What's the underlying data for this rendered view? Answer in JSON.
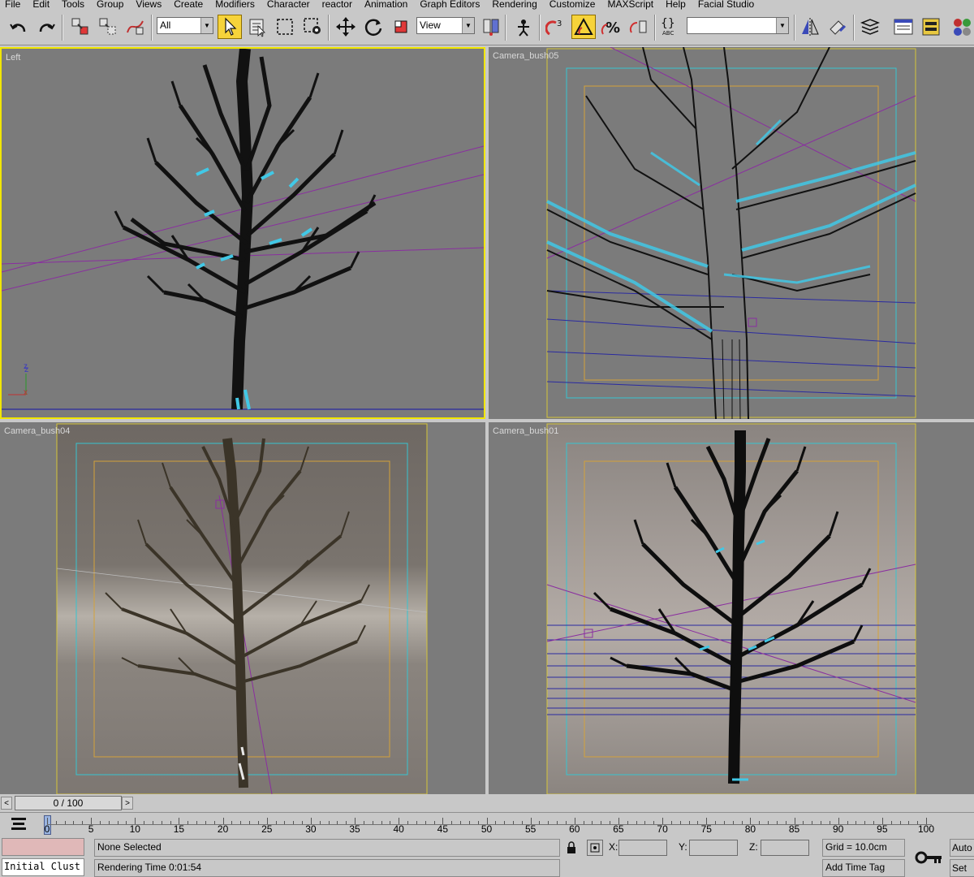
{
  "menu": [
    "File",
    "Edit",
    "Tools",
    "Group",
    "Views",
    "Create",
    "Modifiers",
    "Character",
    "reactor",
    "Animation",
    "Graph Editors",
    "Rendering",
    "Customize",
    "MAXScript",
    "Help",
    "Facial Studio"
  ],
  "toolbar": {
    "selection_filter": "All",
    "reference_coord": "View",
    "named_selection": "",
    "icons": [
      "undo-icon",
      "redo-icon",
      "link-icon",
      "unlink-icon",
      "bind-spacewarp-icon",
      "select-object-icon",
      "select-by-name-icon",
      "rect-region-icon",
      "window-crossing-icon",
      "move-icon",
      "rotate-icon",
      "scale-icon",
      "mirror-icon",
      "align-icon",
      "layer-manager-icon",
      "curve-editor-icon",
      "schematic-view-icon",
      "material-editor-icon"
    ],
    "colors": {
      "active_button": "#f6d33a"
    }
  },
  "viewports": {
    "top_left": {
      "label": "Left"
    },
    "top_right": {
      "label": "Camera_bush05"
    },
    "bottom_left": {
      "label": "Camera_bush04"
    },
    "bottom_right": {
      "label": "Camera_bush01"
    },
    "colors": {
      "active_border": "#f1e600",
      "safe_frame_outer": "#d6c53a",
      "safe_frame_mid": "#37c4d0",
      "safe_frame_inner": "#d4a23a",
      "selection_highlight": "#41c8e6"
    }
  },
  "axis": {
    "z": "z",
    "x": "x"
  },
  "timeslider": {
    "frame_display": "0 / 100",
    "prev": "<",
    "next": ">"
  },
  "trackbar": {
    "ticks": [
      "0",
      "5",
      "10",
      "15",
      "20",
      "25",
      "30",
      "35",
      "40",
      "45",
      "50",
      "55",
      "60",
      "65",
      "70",
      "75",
      "80",
      "85",
      "90",
      "95",
      "100"
    ]
  },
  "status": {
    "maxscript_listener": "Initial Clust",
    "selection": "None Selected",
    "render_time": "Rendering Time  0:01:54",
    "x_label": "X:",
    "y_label": "Y:",
    "z_label": "Z:",
    "x_value": "",
    "y_value": "",
    "z_value": "",
    "grid": "Grid = 10.0cm",
    "add_time_tag": "Add Time Tag",
    "auto_key": "Auto",
    "set_key": "Set"
  }
}
